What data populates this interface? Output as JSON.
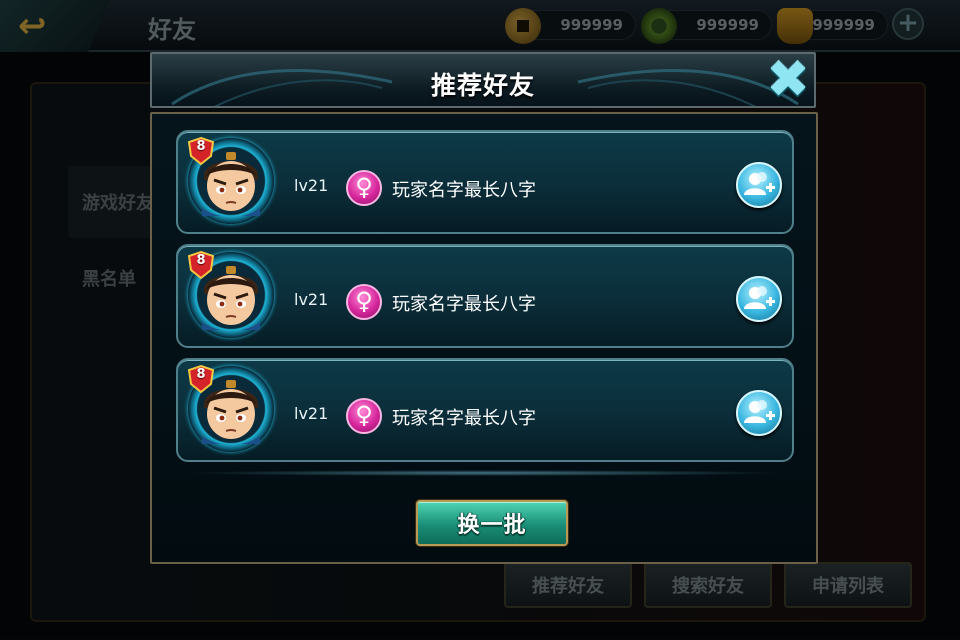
{
  "background": {
    "title": "好友",
    "currencies": [
      {
        "icon": "copper-coin-icon",
        "value": "999999"
      },
      {
        "icon": "jade-coin-icon",
        "value": "999999"
      },
      {
        "icon": "gold-ingot-icon",
        "value": "999999"
      }
    ],
    "side_tabs": [
      "游戏好友",
      "黑名单"
    ],
    "bottom_buttons": [
      "推荐好友",
      "搜索好友",
      "申请列表"
    ]
  },
  "dialog": {
    "title": "推荐好友",
    "close_icon": "close-x-icon",
    "refresh_label": "换一批",
    "players": [
      {
        "badge": "8",
        "level": "lv21",
        "gender": "female",
        "name": "玩家名字最长八字"
      },
      {
        "badge": "8",
        "level": "lv21",
        "gender": "female",
        "name": "玩家名字最长八字"
      },
      {
        "badge": "8",
        "level": "lv21",
        "gender": "female",
        "name": "玩家名字最长八字"
      }
    ]
  },
  "colors": {
    "accent_cyan": "#1eb3d6",
    "female_pink": "#d6279c",
    "button_green": "#1a8f77",
    "border_gold": "#b89a54"
  }
}
